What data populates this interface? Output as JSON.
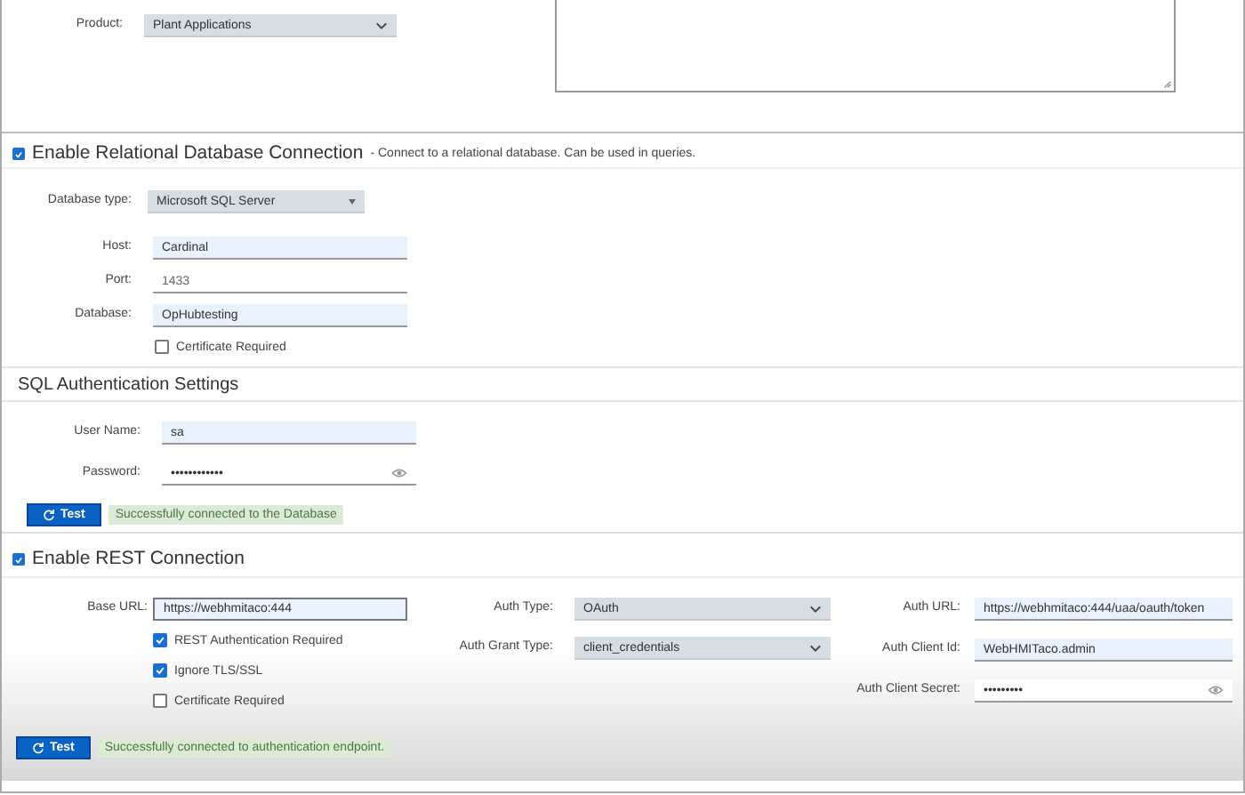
{
  "product": {
    "label": "Product:",
    "value": "Plant Applications"
  },
  "relational_db": {
    "enabled": true,
    "title": "Enable Relational Database Connection",
    "description": "- Connect to a relational database. Can be used in queries.",
    "fields": [
      {
        "kind": "dropdown",
        "label": "Database type:",
        "value": "Microsoft SQL Server"
      },
      {
        "kind": "text",
        "label": "Host:",
        "value": "Cardinal"
      },
      {
        "kind": "plain",
        "label": "Port:",
        "value": "1433"
      },
      {
        "kind": "text",
        "label": "Database:",
        "value": "OpHubtesting"
      }
    ],
    "certificate_required": {
      "label": "Certificate Required",
      "checked": false
    }
  },
  "sql_auth": {
    "title": "SQL Authentication Settings",
    "fields": [
      {
        "kind": "text",
        "label": "User Name:",
        "value": "sa"
      },
      {
        "kind": "password",
        "label": "Password:",
        "value": "••••••••••••"
      }
    ],
    "test_button": "Test",
    "status": "Successfully connected to the Database"
  },
  "rest": {
    "enabled": true,
    "title": "Enable REST Connection",
    "base_url": {
      "kind": "url",
      "label": "Base URL:",
      "value": "https://webhmitaco:444"
    },
    "checkboxes": [
      {
        "label": "REST Authentication Required",
        "checked": true
      },
      {
        "label": "Ignore TLS/SSL",
        "checked": true
      },
      {
        "label": "Certificate Required",
        "checked": false
      }
    ],
    "auth_fields": [
      {
        "kind": "select",
        "label": "Auth Type:",
        "value": "OAuth"
      },
      {
        "kind": "select",
        "label": "Auth Grant Type:",
        "value": "client_credentials"
      }
    ],
    "auth_endpoint_fields": [
      {
        "kind": "text",
        "label": "Auth URL:",
        "value": "https://webhmitaco:444/uaa/oauth/token"
      },
      {
        "kind": "text",
        "label": "Auth Client Id:",
        "value": "WebHMITaco.admin"
      },
      {
        "kind": "password",
        "label": "Auth Client Secret:",
        "value": "•••••••••"
      }
    ],
    "test_button": "Test",
    "status": "Successfully connected to authentication endpoint."
  }
}
